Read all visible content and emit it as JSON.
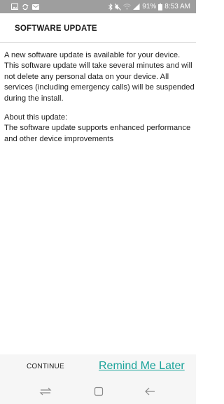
{
  "status_bar": {
    "battery_percent": "91%",
    "time": "8:53 AM",
    "icons_left": [
      "gallery-icon",
      "sync-icon",
      "mail-icon"
    ],
    "icons_right": [
      "bluetooth-icon",
      "mute-icon",
      "wifi-icon",
      "signal-icon",
      "battery-icon"
    ]
  },
  "header": {
    "title": "SOFTWARE UPDATE"
  },
  "content": {
    "intro": "A new software update is available for your device. This software update will take several minutes and will not delete any personal data on your device. All services (including emergency calls) will be suspended during the install.",
    "about_heading": "About this update:",
    "about_body": "The software update supports enhanced performance and other device improvements"
  },
  "actions": {
    "continue_label": "CONTINUE",
    "remind_label": "Remind Me Later"
  },
  "nav": {
    "icons": [
      "recent-apps-icon",
      "home-icon",
      "back-icon"
    ]
  },
  "colors": {
    "status_bar": "#9e9e9e",
    "accent": "#1aa39a",
    "bottom_bar": "#f6f6f6"
  }
}
